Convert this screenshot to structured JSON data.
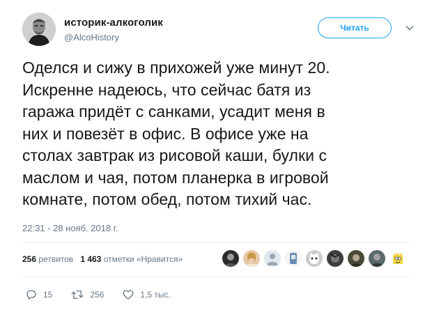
{
  "author": {
    "display_name": "историк-алкоголик",
    "handle": "@AlcoHistory"
  },
  "follow_button": {
    "label": "Читать"
  },
  "tweet": {
    "lines": [
      "Оделся и сижу в прихожей уже минут 20.",
      "Искренне надеюсь, что сейчас батя из",
      "гаража придёт с санками, усадит меня в",
      "них и повезёт в офис. В офисе уже на",
      "столах завтрак из рисовой каши, булки с",
      "маслом и чая, потом планерка в игровой",
      "комнате, потом обед, потом тихий час."
    ],
    "timestamp": "22:31 - 28 нояб. 2018 г."
  },
  "stats": {
    "retweets_count": "256",
    "retweets_label": "ретвитов",
    "likes_count": "1 463",
    "likes_label": "отметки «Нравится»"
  },
  "actions": {
    "replies": "15",
    "retweets": "256",
    "likes": "1,5 тыс."
  },
  "colors": {
    "accent": "#1da1f2",
    "text": "#14171a",
    "secondary": "#657786",
    "divider": "#e6ecf0"
  },
  "icons": {
    "reply": "reply-icon",
    "retweet": "retweet-icon",
    "like": "heart-icon",
    "menu": "chevron-down-icon"
  }
}
